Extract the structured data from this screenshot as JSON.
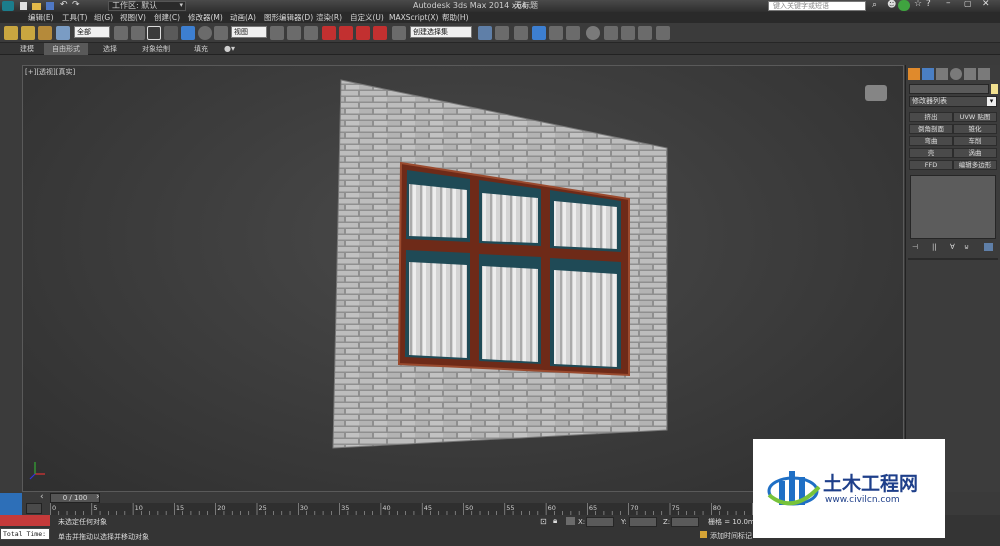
{
  "app": {
    "title": "Autodesk 3ds Max  2014 x64",
    "document_name": "无标题",
    "workspace": "工作区: 默认",
    "search_placeholder": "键入关键字或短语"
  },
  "menu": [
    "编辑(E)",
    "工具(T)",
    "组(G)",
    "视图(V)",
    "创建(C)",
    "修改器(M)",
    "动画(A)",
    "图形编辑器(D)",
    "渲染(R)",
    "自定义(U)",
    "MAXScript(X)",
    "帮助(H)"
  ],
  "toolbar": {
    "selection_filter": "全部",
    "reference_coord": "视图",
    "named_selection": "创建选择集"
  },
  "ribbon": {
    "tabs": [
      "建模",
      "自由形式",
      "选择",
      "对象绘制",
      "填充"
    ]
  },
  "viewport": {
    "label": "[+][透视][真实]",
    "brick_color": "#b9b9b9",
    "mortar_color": "#8f8f8f",
    "frame_color": "#7a2e1a",
    "glass_color": "#1f4a56",
    "curtain_color": "#dcdcdc"
  },
  "command_panel": {
    "modifier_list": "修改器列表",
    "buttons": [
      "挤出",
      "UVW 贴图",
      "倒角剖面",
      "锥化",
      "弯曲",
      "车削",
      "壳",
      "涡曲",
      "FFD",
      "编辑多边形"
    ]
  },
  "timeline": {
    "frame_counter": "0 / 100",
    "ticks": [
      "0",
      "5",
      "10",
      "15",
      "20",
      "25",
      "30",
      "35",
      "40",
      "45",
      "50",
      "55",
      "60",
      "65",
      "70",
      "75",
      "80",
      "85"
    ]
  },
  "status": {
    "line1": "未选定任何对象",
    "line2": "单击并拖动以选择并移动对象",
    "x_label": "X:",
    "y_label": "Y:",
    "z_label": "Z:",
    "grid": "栅格 = 10.0mm",
    "add_time_tag": "添加时间标记",
    "total_time": "Total Time:"
  },
  "watermark": {
    "brand": "土木工程网",
    "url": "www.civilcn.com"
  }
}
